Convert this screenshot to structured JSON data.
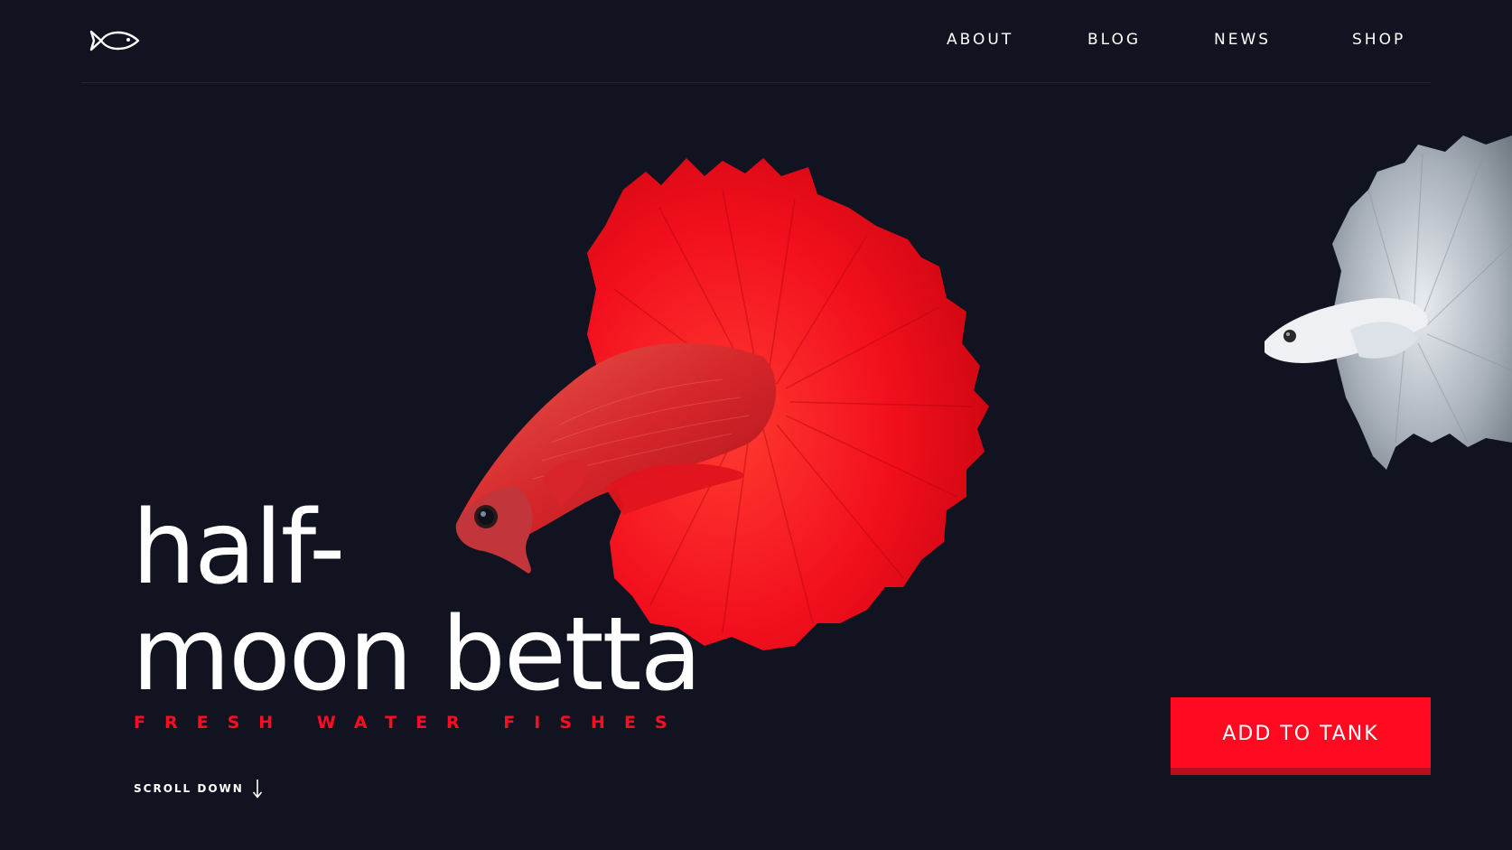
{
  "logo": {
    "icon": "fish-icon"
  },
  "nav": {
    "items": [
      {
        "label": "ABOUT"
      },
      {
        "label": "BLOG"
      },
      {
        "label": "NEWS"
      },
      {
        "label": "SHOP"
      }
    ]
  },
  "hero": {
    "title_line1": "half-",
    "title_line2": "moon betta",
    "subtitle": "FRESH WATER FISHES",
    "scroll_label": "SCROLL DOWN",
    "cta_label": "ADD TO TANK"
  },
  "colors": {
    "background": "#121320",
    "accent": "#ff0a20",
    "text": "#ffffff"
  },
  "images": {
    "main": "red-halfmoon-betta-fish",
    "secondary": "white-halfmoon-betta-fish"
  }
}
